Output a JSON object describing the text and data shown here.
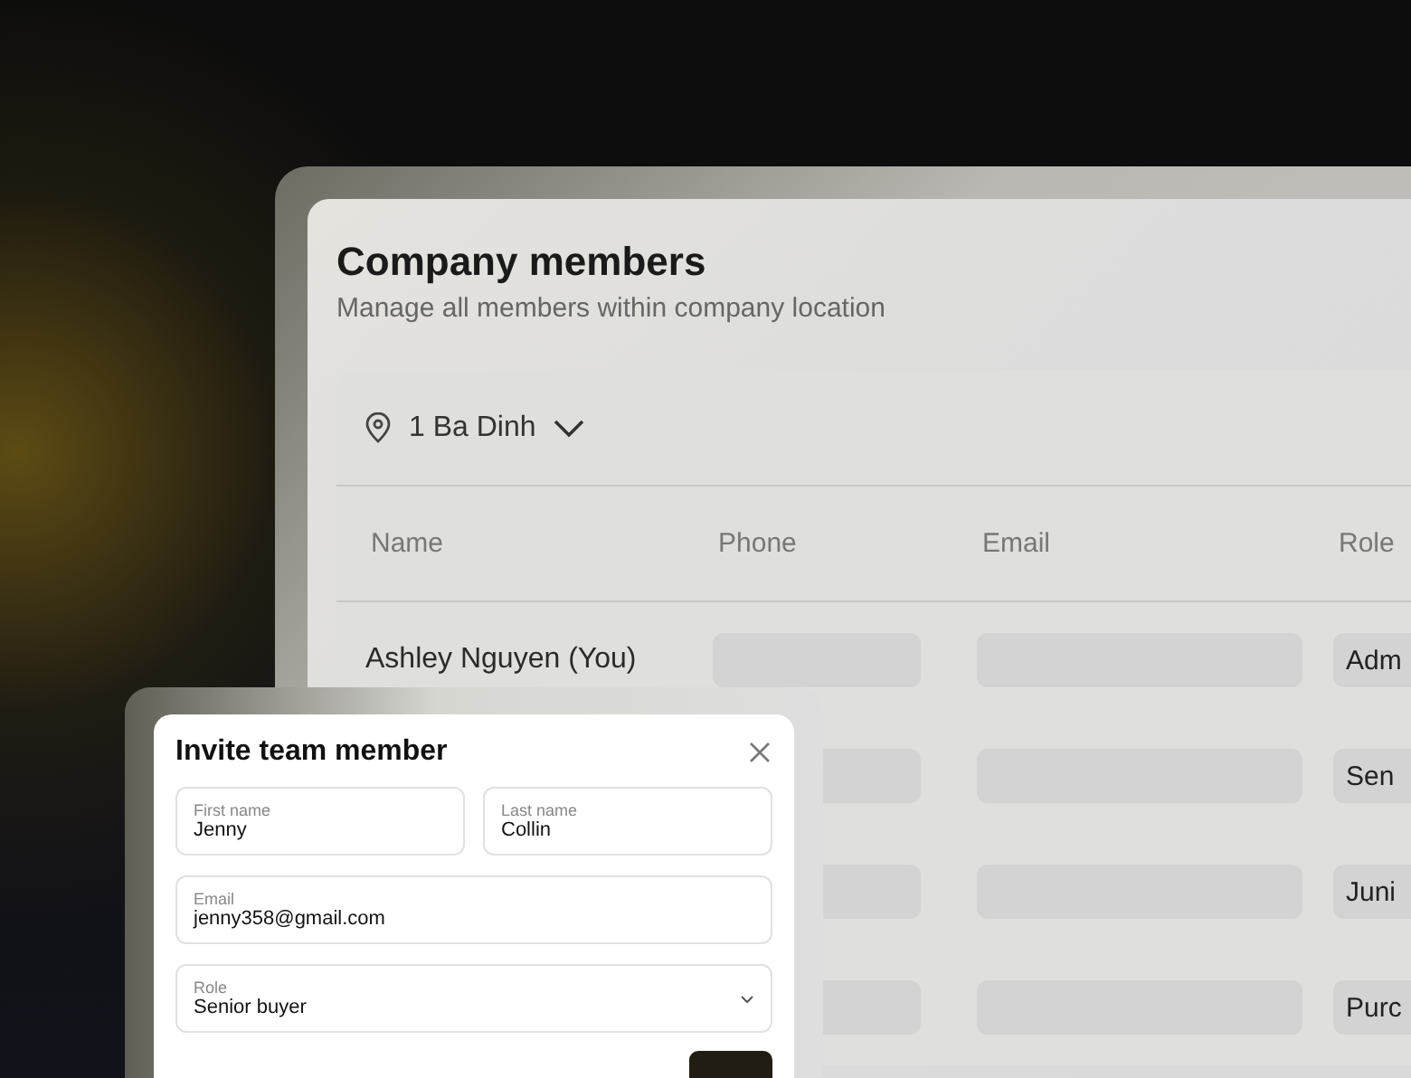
{
  "panel": {
    "title": "Company members",
    "subtitle": "Manage all members within company location",
    "location": {
      "label": "1 Ba Dinh"
    },
    "table": {
      "columns": [
        "Name",
        "Phone",
        "Email",
        "Role"
      ],
      "rows": [
        {
          "name": "Ashley Nguyen (You)",
          "role": "Adm"
        },
        {
          "role": "Sen"
        },
        {
          "role": "Juni"
        },
        {
          "role": "Purc"
        }
      ]
    }
  },
  "dialog": {
    "title": "Invite team member",
    "fields": [
      {
        "kind": "text",
        "label": "First name",
        "value": "Jenny"
      },
      {
        "kind": "text",
        "label": "Last name",
        "value": "Collin"
      },
      {
        "kind": "text",
        "label": "Email",
        "value": "jenny358@gmail.com"
      },
      {
        "kind": "select",
        "label": "Role",
        "value": "Senior buyer"
      }
    ]
  }
}
